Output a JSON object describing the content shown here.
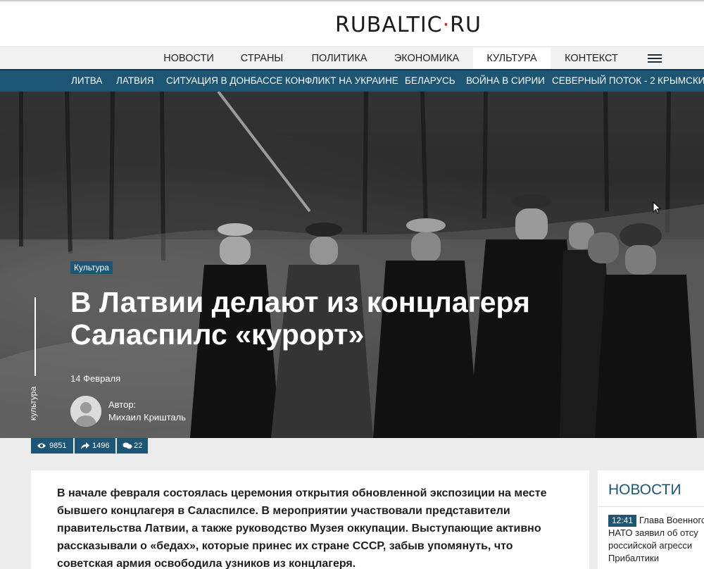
{
  "site": {
    "logo_main": "RUBALTIC",
    "logo_dot": "·",
    "logo_tld": "RU"
  },
  "main_nav": [
    {
      "label": "НОВОСТИ",
      "active": false
    },
    {
      "label": "СТРАНЫ",
      "active": false
    },
    {
      "label": "ПОЛИТИКА",
      "active": false
    },
    {
      "label": "ЭКОНОМИКА",
      "active": false
    },
    {
      "label": "КУЛЬТУРА",
      "active": true
    },
    {
      "label": "КОНТЕКСТ",
      "active": false
    }
  ],
  "sub_nav": [
    "ЛИТВА",
    "ЛАТВИЯ",
    "СИТУАЦИЯ В ДОНБАССЕ",
    "КОНФЛИКТ НА УКРАИНЕ",
    "БЕЛАРУСЬ",
    "ВОЙНА В СИРИИ",
    "СЕВЕРНЫЙ ПОТОК - 2",
    "КРЫМСКИЙ"
  ],
  "article": {
    "category_badge": "Культура",
    "title": "В Латвии делают из концлагеря Саласпилс «курорт»",
    "date": "14 Февраля",
    "author_label": "Автор:",
    "author_name": "Михаил Кришталь",
    "side_category": "культура",
    "stats": {
      "views": "9851",
      "shares": "1496",
      "comments": "22"
    },
    "lead": "В начале февраля состоялась церемония открытия обновленной экспозиции на месте бывшего концлагеря в Саласпилсе. В мероприятии участвовали представители правительства Латвии, а также руководство Музея оккупации. Выступающие активно рассказывали о «бедах», которые принес их стране СССР, забыв упомянуть, что советская армия освободила узников из концлагеря."
  },
  "sidebar": {
    "title": "НОВОСТИ",
    "items": [
      {
        "time": "12:41",
        "text": "Глава Военного НАТО заявил об отсу российской агресси Прибалтики"
      }
    ]
  },
  "colors": {
    "accent": "#1d5574",
    "logo_red": "#d9241c"
  }
}
